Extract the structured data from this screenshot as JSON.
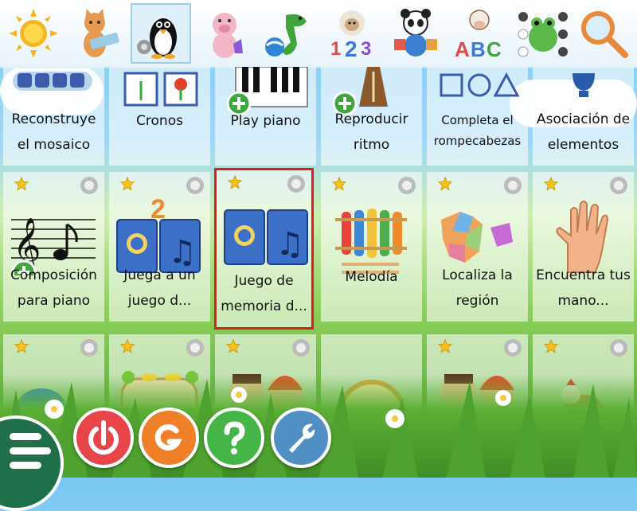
{
  "categories": [
    {
      "name": "sun",
      "icon": "sun-icon"
    },
    {
      "name": "cat-computer",
      "icon": "cat-keyboard-icon"
    },
    {
      "name": "penguin",
      "icon": "penguin-icon",
      "selected": true
    },
    {
      "name": "pig",
      "icon": "pig-icon"
    },
    {
      "name": "dinosaur",
      "icon": "dinosaur-ball-icon"
    },
    {
      "name": "sheep-numbers",
      "icon": "sheep-123-icon"
    },
    {
      "name": "panda-puzzle",
      "icon": "panda-puzzle-icon"
    },
    {
      "name": "cow-letters",
      "icon": "cow-abc-icon"
    },
    {
      "name": "frog",
      "icon": "frog-icon"
    },
    {
      "name": "search",
      "icon": "magnifier-icon"
    }
  ],
  "tiles_row1": [
    {
      "label_lines": [
        "Reconstruye",
        "el mosaico"
      ]
    },
    {
      "label_lines": [
        "Cronos"
      ]
    },
    {
      "label_lines": [
        "Play piano"
      ]
    },
    {
      "label_lines": [
        "Reproducir",
        "ritmo"
      ]
    },
    {
      "label_lines": [
        "Completa el",
        "rompecabezas"
      ]
    },
    {
      "label_lines": [
        "Asociación de",
        "elementos"
      ]
    }
  ],
  "tiles_row2": [
    {
      "label_lines": [
        "Composición",
        "para piano"
      ]
    },
    {
      "label_lines": [
        "Juega a un",
        "juego d..."
      ]
    },
    {
      "label_lines": [
        "Juego de",
        "memoria d..."
      ],
      "active": true
    },
    {
      "label_lines": [
        "Melodía"
      ]
    },
    {
      "label_lines": [
        "Localiza la",
        "región"
      ]
    },
    {
      "label_lines": [
        "Encuentra tus",
        "mano..."
      ]
    }
  ],
  "bottom_buttons": [
    "exit",
    "gcompris",
    "help",
    "settings"
  ],
  "colors": {
    "accent_red": "#e01b1b",
    "exit_btn": "#e8454b",
    "gcompris_btn": "#f07f2a",
    "help_btn": "#45b548",
    "settings_btn": "#4f8fc3",
    "menu_btn": "#1f6f4a"
  }
}
